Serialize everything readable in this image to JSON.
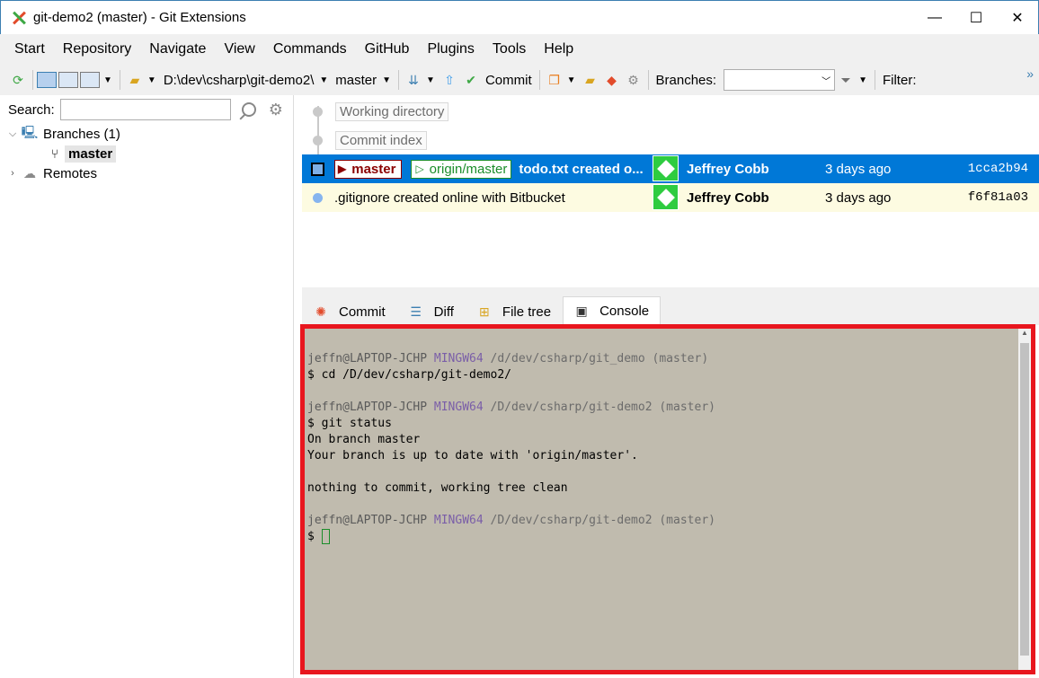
{
  "window": {
    "title": "git-demo2 (master) - Git Extensions",
    "minimize": "—",
    "maximize": "☐",
    "close": "✕"
  },
  "menu": [
    "Start",
    "Repository",
    "Navigate",
    "View",
    "Commands",
    "GitHub",
    "Plugins",
    "Tools",
    "Help"
  ],
  "toolbar": {
    "path": "D:\\dev\\csharp\\git-demo2\\",
    "branch": "master",
    "commit_label": "Commit",
    "branches_label": "Branches:",
    "branches_value": "",
    "filter_label": "Filter:"
  },
  "left": {
    "search_label": "Search:",
    "search_value": "",
    "branches_node": "Branches (1)",
    "master_node": "master",
    "remotes_node": "Remotes"
  },
  "grid": {
    "working_directory": "Working directory",
    "commit_index": "Commit index",
    "rows": [
      {
        "ref_local": "master",
        "ref_remote": "origin/master",
        "message": "todo.txt created o...",
        "author": "Jeffrey Cobb",
        "date": "3 days ago",
        "hash": "1cca2b94"
      },
      {
        "message": ".gitignore created online with Bitbucket",
        "author": "Jeffrey Cobb",
        "date": "3 days ago",
        "hash": "f6f81a03"
      }
    ]
  },
  "tabs": [
    "Commit",
    "Diff",
    "File tree",
    "Console"
  ],
  "console": {
    "user": "jeffn@LAPTOP-JCHP",
    "mingw": "MINGW64",
    "path1": "/d/dev/csharp/git_demo",
    "branch": "(master)",
    "cmd1": "$ cd /D/dev/csharp/git-demo2/",
    "path2": "/D/dev/csharp/git-demo2",
    "cmd2": "$ git status",
    "out1": "On branch master",
    "out2": "Your branch is up to date with 'origin/master'.",
    "out3": "nothing to commit, working tree clean",
    "prompt": "$ "
  }
}
